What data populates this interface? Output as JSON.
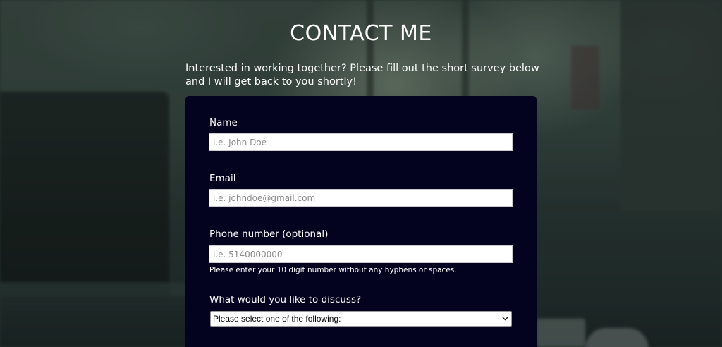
{
  "page": {
    "title": "CONTACT ME",
    "intro": "Interested in working together? Please fill out the short survey below and I will get back to you shortly!"
  },
  "form": {
    "name": {
      "label": "Name",
      "placeholder": "i.e. John Doe",
      "value": ""
    },
    "email": {
      "label": "Email",
      "placeholder": "i.e. johndoe@gmail.com",
      "value": ""
    },
    "phone": {
      "label": "Phone number (optional)",
      "placeholder": "i.e. 5140000000",
      "value": "",
      "hint": "Please enter your 10 digit number without any hyphens or spaces."
    },
    "topic": {
      "label": "What would you like to discuss?",
      "selected": "Please select one of the following:"
    }
  },
  "colors": {
    "card_background": "#03031f",
    "text": "#ffffff",
    "input_background": "#ffffff"
  },
  "icons": {
    "select_chevron": "chevron-down-icon"
  }
}
